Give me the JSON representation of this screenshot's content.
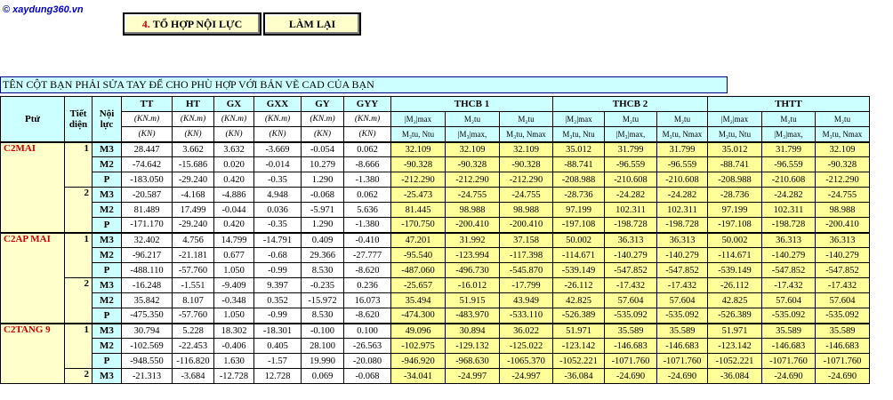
{
  "logo": {
    "copyright": "©",
    "text": "xaydung360.vn"
  },
  "toolbar": {
    "combine_number": "4.",
    "combine_label": "TỔ HỢP NỘI LỰC",
    "reset_label": "LÀM LẠI"
  },
  "note": "TÊN CỘT BẠN PHẢI SỬA TAY ĐỂ CHO PHÙ HỢP VỚI BẢN VẼ CAD CỦA BẠN",
  "headers": {
    "column": "Ptử",
    "section": "Tiết diện",
    "force": "Nội lực",
    "cases": [
      "TT",
      "HT",
      "GX",
      "GXX",
      "GY",
      "GYY"
    ],
    "units1": [
      "(KN.m)",
      "(KN.m)",
      "(KN.m)",
      "(KN.m)",
      "(KN.m)",
      "(KN.m)"
    ],
    "units2": [
      "(KN)",
      "(KN)",
      "(KN)",
      "(KN)",
      "(KN)",
      "(KN)"
    ],
    "groups": [
      "THCB 1",
      "THCB 2",
      "THTT"
    ],
    "sub1": [
      "|M₂|max",
      "M₂tu",
      "M₂tu",
      "|M₂|max",
      "M₂tu",
      "M₂tu",
      "|M₂|max",
      "M₂tu",
      "M₂tu"
    ],
    "sub2": [
      "M₃tu, Ntu",
      "|M₃|max,",
      "M₃tu, Nmax",
      "M₃tu, Ntu",
      "|M₃|max,",
      "M₃tu, Nmax",
      "M₃tu, Ntu",
      "|M₃|max,",
      "M₃tu, Nmax"
    ]
  },
  "elements": [
    {
      "name": "C2MAI",
      "sections": [
        {
          "section": "1",
          "rows": [
            {
              "force": "M3",
              "loads": [
                "28.447",
                "3.662",
                "3.632",
                "-3.669",
                "-0.054",
                "0.062"
              ],
              "results": [
                "32.109",
                "32.109",
                "32.109",
                "35.012",
                "31.799",
                "31.799",
                "35.012",
                "31.799",
                "32.109"
              ]
            },
            {
              "force": "M2",
              "loads": [
                "-74.642",
                "-15.686",
                "0.020",
                "-0.014",
                "10.279",
                "-8.666"
              ],
              "results": [
                "-90.328",
                "-90.328",
                "-90.328",
                "-88.741",
                "-96.559",
                "-96.559",
                "-88.741",
                "-96.559",
                "-90.328"
              ]
            },
            {
              "force": "P",
              "loads": [
                "-183.050",
                "-29.240",
                "0.420",
                "-0.35",
                "1.290",
                "-1.380"
              ],
              "results": [
                "-212.290",
                "-212.290",
                "-212.290",
                "-208.988",
                "-210.608",
                "-210.608",
                "-208.988",
                "-210.608",
                "-212.290"
              ]
            }
          ]
        },
        {
          "section": "2",
          "rows": [
            {
              "force": "M3",
              "loads": [
                "-20.587",
                "-4.168",
                "-4.886",
                "4.948",
                "-0.068",
                "0.062"
              ],
              "results": [
                "-25.473",
                "-24.755",
                "-24.755",
                "-28.736",
                "-24.282",
                "-24.282",
                "-28.736",
                "-24.282",
                "-24.755"
              ]
            },
            {
              "force": "M2",
              "loads": [
                "81.489",
                "17.499",
                "-0.044",
                "0.036",
                "-5.971",
                "5.636"
              ],
              "results": [
                "81.445",
                "98.988",
                "98.988",
                "97.199",
                "102.311",
                "102.311",
                "97.199",
                "102.311",
                "98.988"
              ]
            },
            {
              "force": "P",
              "loads": [
                "-171.170",
                "-29.240",
                "0.420",
                "-0.35",
                "1.290",
                "-1.380"
              ],
              "results": [
                "-170.750",
                "-200.410",
                "-200.410",
                "-197.108",
                "-198.728",
                "-198.728",
                "-197.108",
                "-198.728",
                "-200.410"
              ]
            }
          ]
        }
      ]
    },
    {
      "name": "C2AP MAI",
      "sections": [
        {
          "section": "1",
          "rows": [
            {
              "force": "M3",
              "loads": [
                "32.402",
                "4.756",
                "14.799",
                "-14.791",
                "0.409",
                "-0.410"
              ],
              "results": [
                "47.201",
                "31.992",
                "37.158",
                "50.002",
                "36.313",
                "36.313",
                "50.002",
                "36.313",
                "36.313"
              ]
            },
            {
              "force": "M2",
              "loads": [
                "-96.217",
                "-21.181",
                "0.677",
                "-0.68",
                "29.366",
                "-27.777"
              ],
              "results": [
                "-95.540",
                "-123.994",
                "-117.398",
                "-114.671",
                "-140.279",
                "-140.279",
                "-114.671",
                "-140.279",
                "-140.279"
              ]
            },
            {
              "force": "P",
              "loads": [
                "-488.110",
                "-57.760",
                "1.050",
                "-0.99",
                "8.530",
                "-8.620"
              ],
              "results": [
                "-487.060",
                "-496.730",
                "-545.870",
                "-539.149",
                "-547.852",
                "-547.852",
                "-539.149",
                "-547.852",
                "-547.852"
              ]
            }
          ]
        },
        {
          "section": "2",
          "rows": [
            {
              "force": "M3",
              "loads": [
                "-16.248",
                "-1.551",
                "-9.409",
                "9.397",
                "-0.235",
                "0.236"
              ],
              "results": [
                "-25.657",
                "-16.012",
                "-17.799",
                "-26.112",
                "-17.432",
                "-17.432",
                "-26.112",
                "-17.432",
                "-17.432"
              ]
            },
            {
              "force": "M2",
              "loads": [
                "35.842",
                "8.107",
                "-0.348",
                "0.352",
                "-15.972",
                "16.073"
              ],
              "results": [
                "35.494",
                "51.915",
                "43.949",
                "42.825",
                "57.604",
                "57.604",
                "42.825",
                "57.604",
                "57.604"
              ]
            },
            {
              "force": "P",
              "loads": [
                "-475.350",
                "-57.760",
                "1.050",
                "-0.99",
                "8.530",
                "-8.620"
              ],
              "results": [
                "-474.300",
                "-483.970",
                "-533.110",
                "-526.389",
                "-535.092",
                "-535.092",
                "-526.389",
                "-535.092",
                "-535.092"
              ]
            }
          ]
        }
      ]
    },
    {
      "name": "C2TANG 9",
      "sections": [
        {
          "section": "1",
          "rows": [
            {
              "force": "M3",
              "loads": [
                "30.794",
                "5.228",
                "18.302",
                "-18.301",
                "-0.100",
                "0.100"
              ],
              "results": [
                "49.096",
                "30.894",
                "36.022",
                "51.971",
                "35.589",
                "35.589",
                "51.971",
                "35.589",
                "35.589"
              ]
            },
            {
              "force": "M2",
              "loads": [
                "-102.569",
                "-22.453",
                "-0.406",
                "0.405",
                "28.100",
                "-26.563"
              ],
              "results": [
                "-102.975",
                "-129.132",
                "-125.022",
                "-123.142",
                "-146.683",
                "-146.683",
                "-123.142",
                "-146.683",
                "-146.683"
              ]
            },
            {
              "force": "P",
              "loads": [
                "-948.550",
                "-116.820",
                "1.630",
                "-1.57",
                "19.990",
                "-20.080"
              ],
              "results": [
                "-946.920",
                "-968.630",
                "-1065.370",
                "-1052.221",
                "-1071.760",
                "-1071.760",
                "-1052.221",
                "-1071.760",
                "-1071.760"
              ]
            }
          ]
        },
        {
          "section": "2",
          "rows": [
            {
              "force": "M3",
              "loads": [
                "-21.313",
                "-3.684",
                "-12.728",
                "12.728",
                "0.069",
                "-0.068"
              ],
              "results": [
                "-34.041",
                "-24.997",
                "-24.997",
                "-36.084",
                "-24.690",
                "-24.690",
                "-36.084",
                "-24.690",
                "-24.690"
              ]
            }
          ]
        }
      ]
    }
  ]
}
